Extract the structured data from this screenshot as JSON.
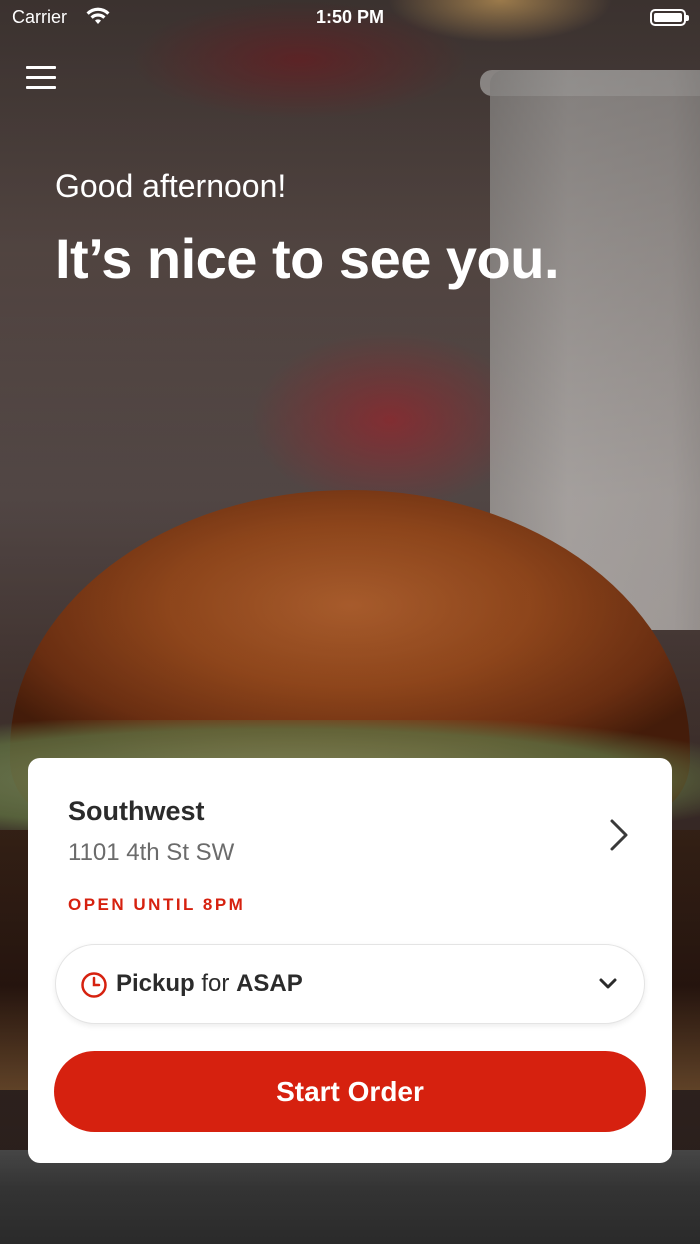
{
  "status_bar": {
    "carrier": "Carrier",
    "time": "1:50 PM"
  },
  "hero": {
    "greeting": "Good afternoon!",
    "headline": "It’s nice to see you."
  },
  "store": {
    "name": "Southwest",
    "address": "1101 4th St SW",
    "open_status": "OPEN UNTIL 8PM"
  },
  "order_mode": {
    "mode": "Pickup",
    "connector": "for",
    "time": "ASAP"
  },
  "actions": {
    "start_order_label": "Start Order"
  },
  "colors": {
    "accent": "#d6210f",
    "card_bg": "#ffffff",
    "text_primary": "#2b2b2b",
    "text_secondary": "#6b6b6b"
  },
  "icons": {
    "menu": "hamburger-menu-icon",
    "store_chevron": "chevron-right-icon",
    "pickup_clock": "clock-icon",
    "pickup_dropdown": "chevron-down-icon",
    "wifi": "wifi-icon",
    "battery": "battery-icon"
  }
}
